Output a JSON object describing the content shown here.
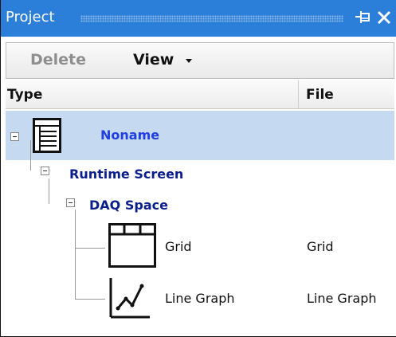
{
  "panel": {
    "title": "Project",
    "pin_icon": "pin-icon",
    "close_icon": "close-icon",
    "accent_color": "#2c7fd9"
  },
  "toolbar": {
    "delete_label": "Delete",
    "view_label": "View",
    "delete_enabled": false
  },
  "columns": {
    "type": "Type",
    "file": "File"
  },
  "tree": {
    "root": {
      "label": "Noname",
      "icon": "document-list-icon",
      "selected": true,
      "file": ""
    },
    "runtime": {
      "label": "Runtime Screen",
      "file": ""
    },
    "daq": {
      "label": "DAQ Space",
      "file": ""
    },
    "grid": {
      "label": "Grid",
      "icon": "grid-icon",
      "file": "Grid"
    },
    "linegraph": {
      "label": "Line Graph",
      "icon": "line-graph-icon",
      "file": "Line Graph"
    }
  },
  "colors": {
    "selection": "#c5d9f0",
    "node_text": "#0b1f8c"
  }
}
